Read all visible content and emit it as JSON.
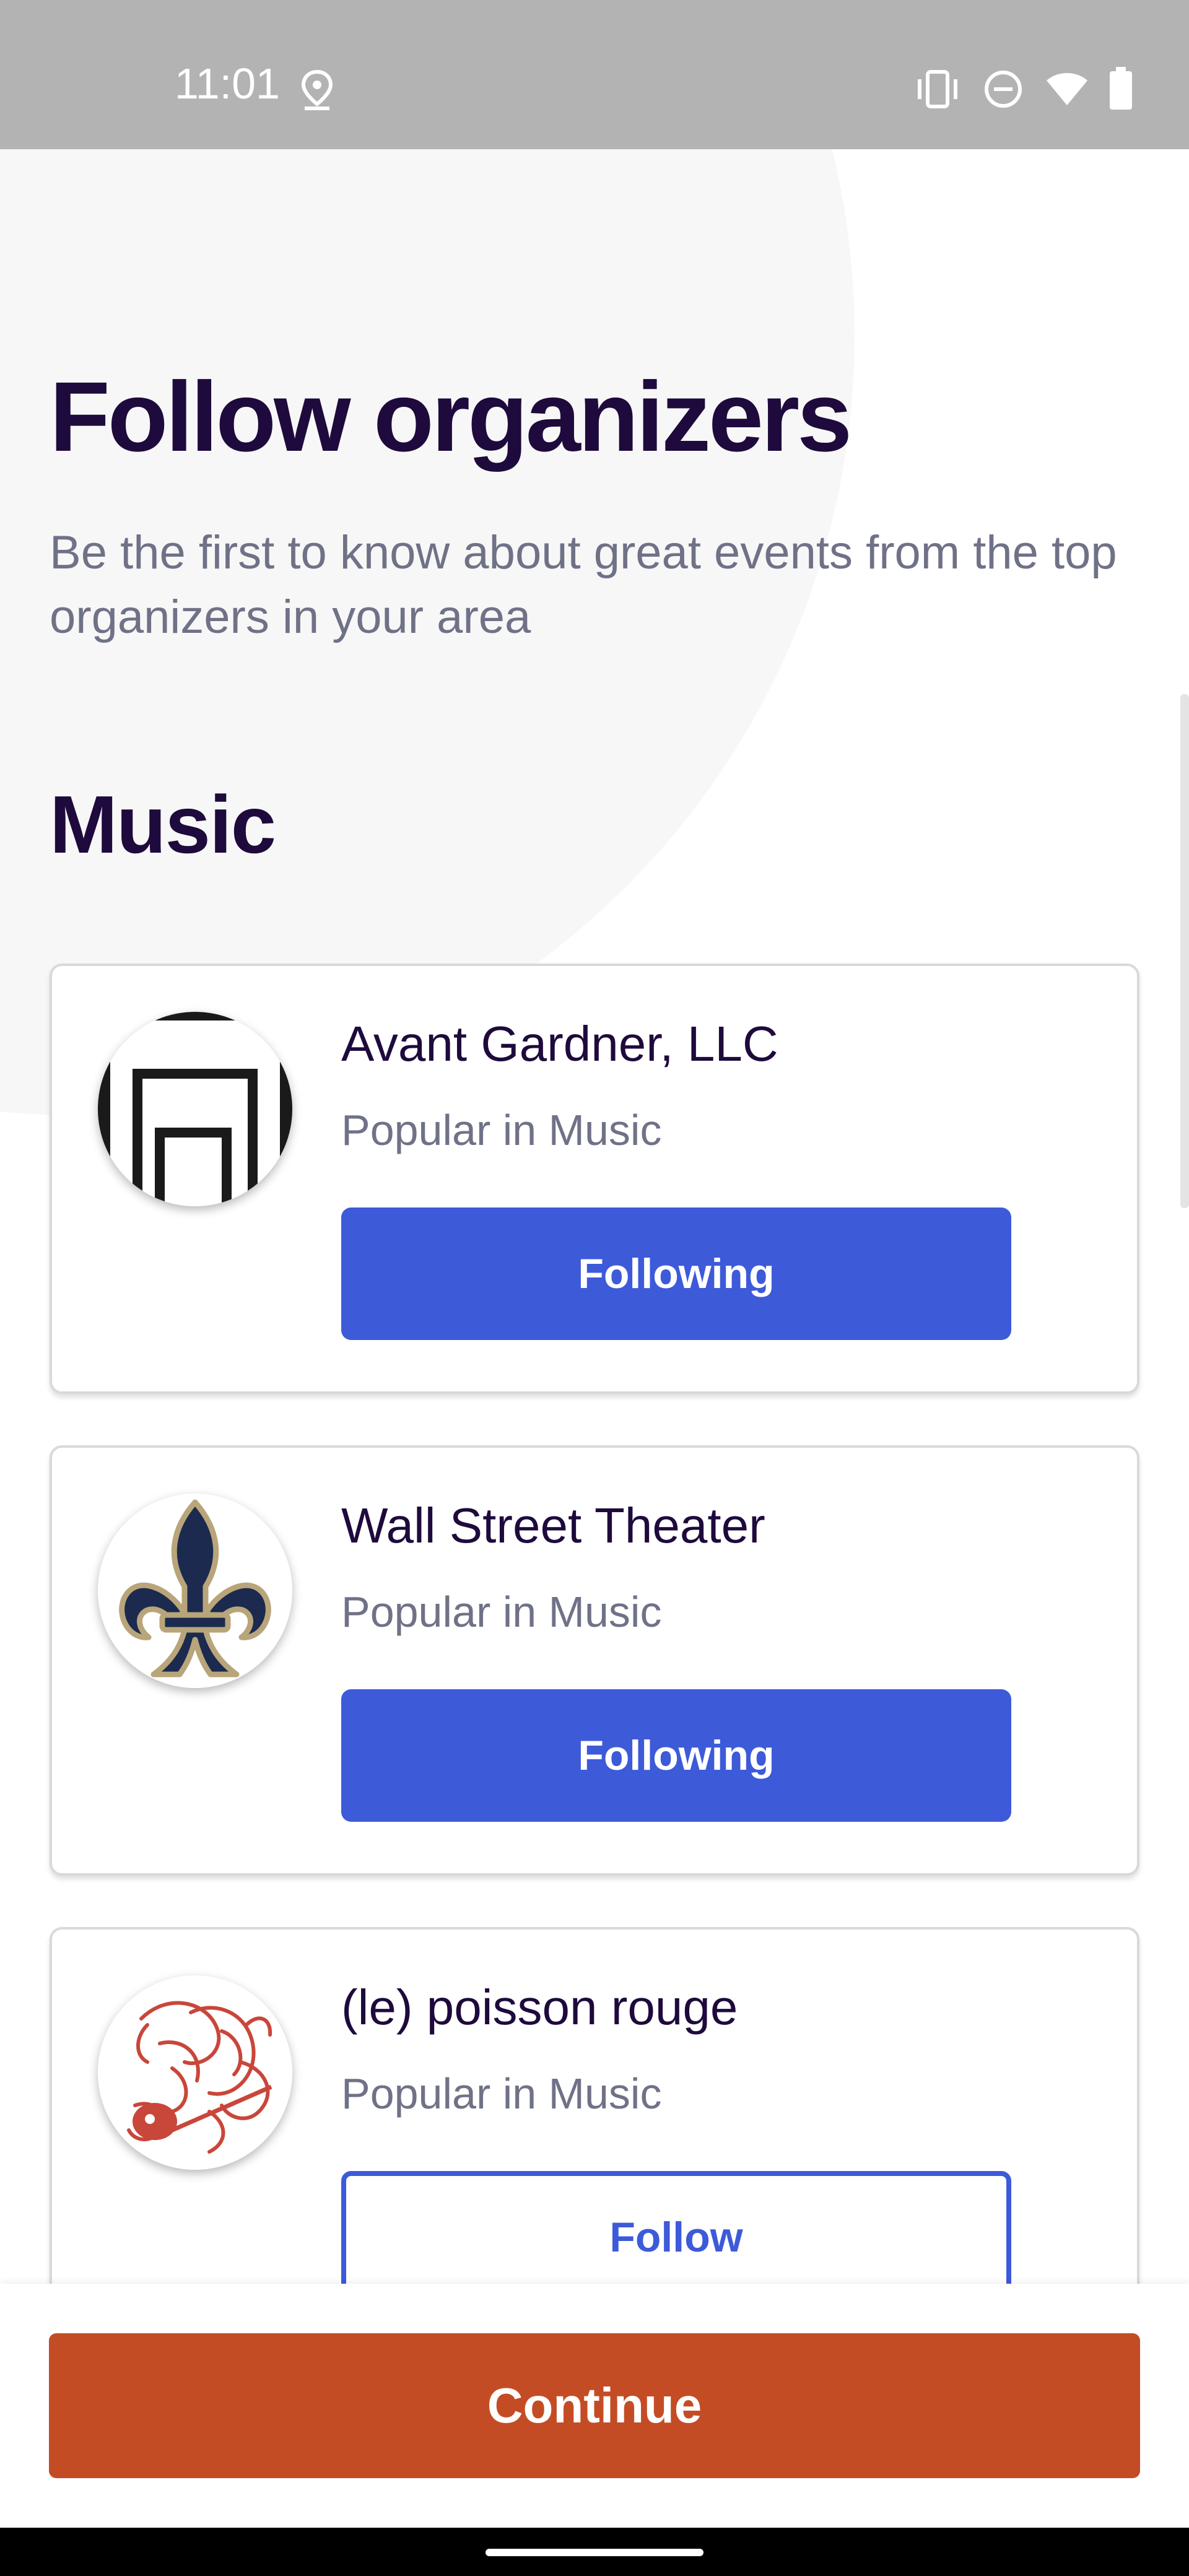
{
  "status_bar": {
    "time": "11:01",
    "icons": [
      "location-icon",
      "vibrate-icon",
      "do-not-disturb-icon",
      "wifi-icon",
      "battery-icon"
    ]
  },
  "page": {
    "title": "Follow organizers",
    "subtitle": "Be the first to know about great events from the top organizers in your area"
  },
  "section": {
    "title": "Music"
  },
  "organizers": [
    {
      "name": "Avant Gardner, LLC",
      "subtitle": "Popular in Music",
      "button_label": "Following",
      "following": true,
      "logo": "avant-gardner-logo"
    },
    {
      "name": "Wall Street Theater",
      "subtitle": "Popular in Music",
      "button_label": "Following",
      "following": true,
      "logo": "fleur-de-lis-logo"
    },
    {
      "name": "(le) poisson rouge",
      "subtitle": "Popular in Music",
      "button_label": "Follow",
      "following": false,
      "logo": "poisson-rouge-logo"
    }
  ],
  "footer": {
    "continue_label": "Continue"
  },
  "colors": {
    "primary_blue": "#3d5ad9",
    "continue_orange": "#c44c24",
    "title_dark": "#1e0a3c",
    "muted_text": "#6f7287"
  }
}
